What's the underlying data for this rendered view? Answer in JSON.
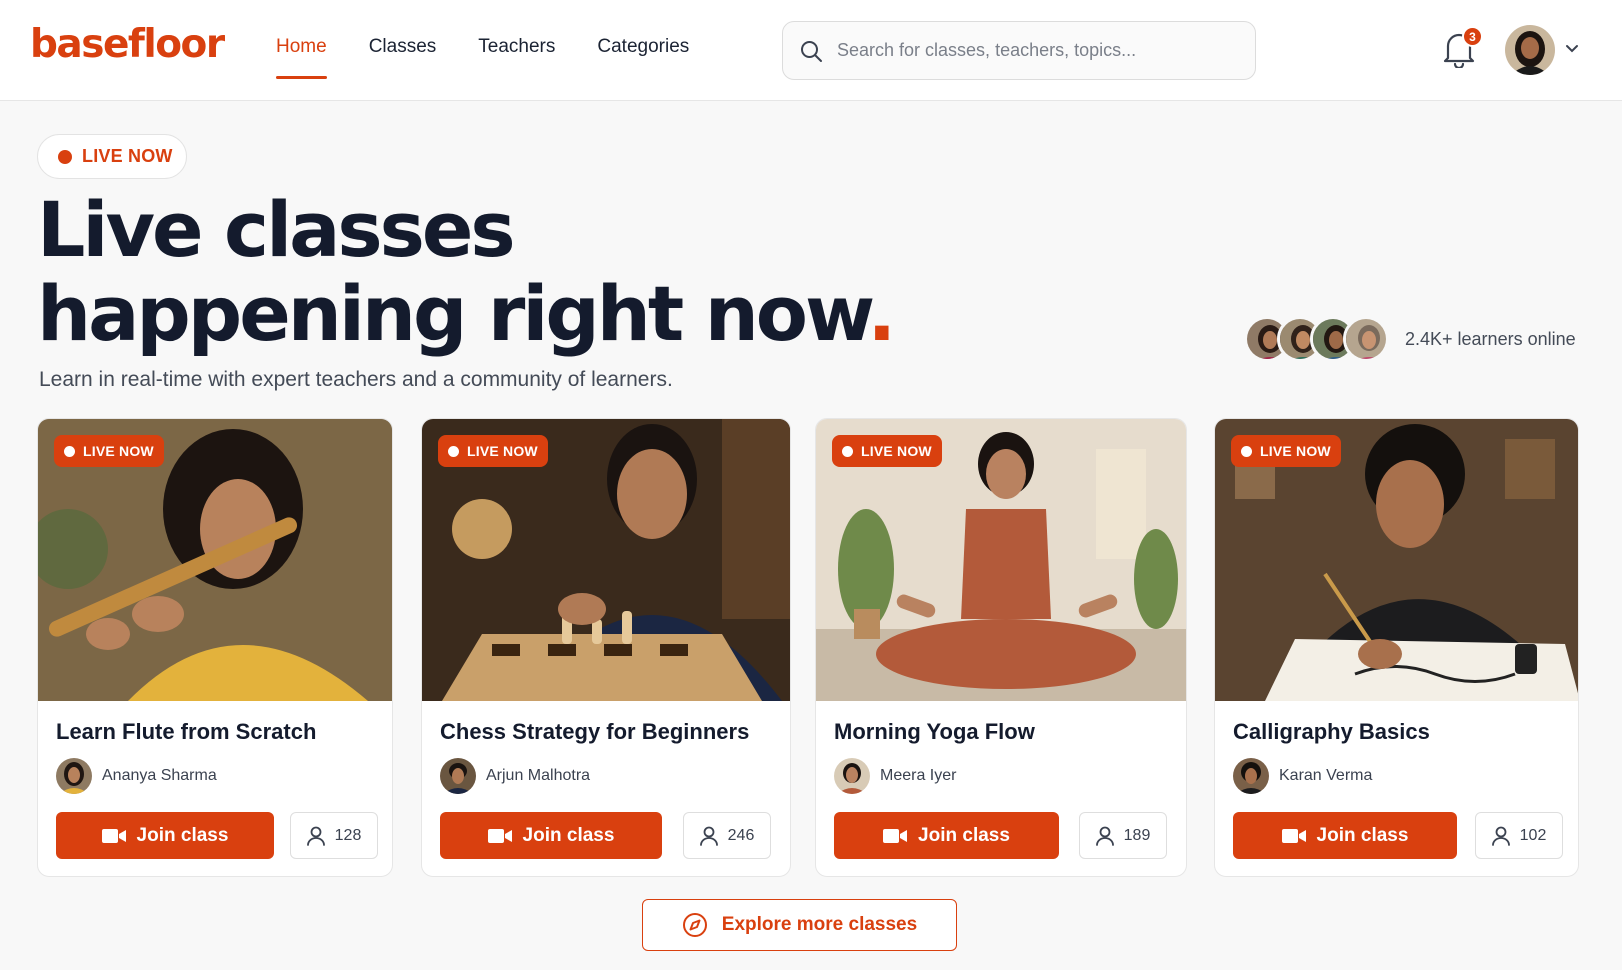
{
  "brand": {
    "name": "basefloor",
    "accent": "#d9400f"
  },
  "nav": {
    "items": [
      {
        "label": "Home",
        "active": true
      },
      {
        "label": "Classes",
        "active": false
      },
      {
        "label": "Teachers",
        "active": false
      },
      {
        "label": "Categories",
        "active": false
      }
    ]
  },
  "search": {
    "placeholder": "Search for classes, teachers, topics..."
  },
  "notifications": {
    "count": "3",
    "icon": "bell-icon"
  },
  "profile": {
    "icon": "chevron-down-icon"
  },
  "hero": {
    "badge": "LIVE NOW",
    "title_line1": "Live classes",
    "title_line2": "happening right now",
    "title_dot": ".",
    "subtitle": "Learn in real-time with expert teachers and a community of learners.",
    "learners_online": "2.4K+ learners online"
  },
  "cards": [
    {
      "badge": "LIVE NOW",
      "title": "Learn Flute from Scratch",
      "teacher": "Ananya Sharma",
      "join_label": "Join class",
      "attendees": "128"
    },
    {
      "badge": "LIVE NOW",
      "title": "Chess Strategy for Beginners",
      "teacher": "Arjun Malhotra",
      "join_label": "Join class",
      "attendees": "246"
    },
    {
      "badge": "LIVE NOW",
      "title": "Morning Yoga Flow",
      "teacher": "Meera Iyer",
      "join_label": "Join class",
      "attendees": "189"
    },
    {
      "badge": "LIVE NOW",
      "title": "Calligraphy Basics",
      "teacher": "Karan Verma",
      "join_label": "Join class",
      "attendees": "102"
    }
  ],
  "explore": {
    "label": "Explore more classes",
    "icon": "compass-icon"
  }
}
